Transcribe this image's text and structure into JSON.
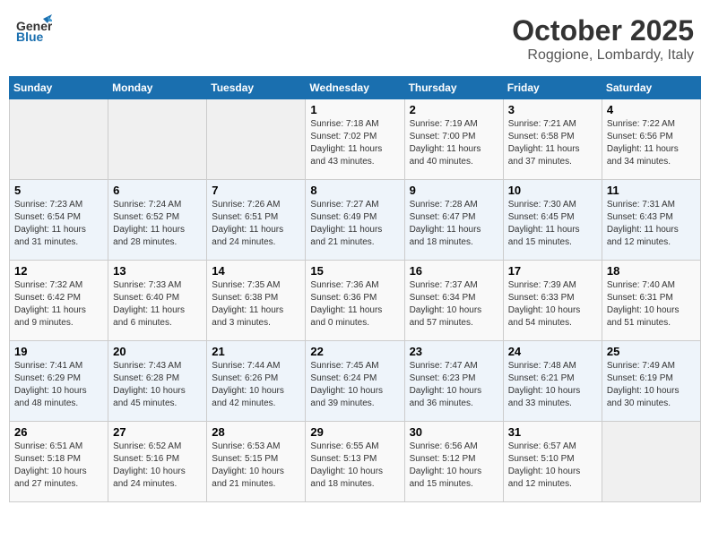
{
  "header": {
    "logo_general": "General",
    "logo_blue": "Blue",
    "month": "October 2025",
    "location": "Roggione, Lombardy, Italy"
  },
  "weekdays": [
    "Sunday",
    "Monday",
    "Tuesday",
    "Wednesday",
    "Thursday",
    "Friday",
    "Saturday"
  ],
  "weeks": [
    [
      {
        "day": "",
        "info": ""
      },
      {
        "day": "",
        "info": ""
      },
      {
        "day": "",
        "info": ""
      },
      {
        "day": "1",
        "info": "Sunrise: 7:18 AM\nSunset: 7:02 PM\nDaylight: 11 hours\nand 43 minutes."
      },
      {
        "day": "2",
        "info": "Sunrise: 7:19 AM\nSunset: 7:00 PM\nDaylight: 11 hours\nand 40 minutes."
      },
      {
        "day": "3",
        "info": "Sunrise: 7:21 AM\nSunset: 6:58 PM\nDaylight: 11 hours\nand 37 minutes."
      },
      {
        "day": "4",
        "info": "Sunrise: 7:22 AM\nSunset: 6:56 PM\nDaylight: 11 hours\nand 34 minutes."
      }
    ],
    [
      {
        "day": "5",
        "info": "Sunrise: 7:23 AM\nSunset: 6:54 PM\nDaylight: 11 hours\nand 31 minutes."
      },
      {
        "day": "6",
        "info": "Sunrise: 7:24 AM\nSunset: 6:52 PM\nDaylight: 11 hours\nand 28 minutes."
      },
      {
        "day": "7",
        "info": "Sunrise: 7:26 AM\nSunset: 6:51 PM\nDaylight: 11 hours\nand 24 minutes."
      },
      {
        "day": "8",
        "info": "Sunrise: 7:27 AM\nSunset: 6:49 PM\nDaylight: 11 hours\nand 21 minutes."
      },
      {
        "day": "9",
        "info": "Sunrise: 7:28 AM\nSunset: 6:47 PM\nDaylight: 11 hours\nand 18 minutes."
      },
      {
        "day": "10",
        "info": "Sunrise: 7:30 AM\nSunset: 6:45 PM\nDaylight: 11 hours\nand 15 minutes."
      },
      {
        "day": "11",
        "info": "Sunrise: 7:31 AM\nSunset: 6:43 PM\nDaylight: 11 hours\nand 12 minutes."
      }
    ],
    [
      {
        "day": "12",
        "info": "Sunrise: 7:32 AM\nSunset: 6:42 PM\nDaylight: 11 hours\nand 9 minutes."
      },
      {
        "day": "13",
        "info": "Sunrise: 7:33 AM\nSunset: 6:40 PM\nDaylight: 11 hours\nand 6 minutes."
      },
      {
        "day": "14",
        "info": "Sunrise: 7:35 AM\nSunset: 6:38 PM\nDaylight: 11 hours\nand 3 minutes."
      },
      {
        "day": "15",
        "info": "Sunrise: 7:36 AM\nSunset: 6:36 PM\nDaylight: 11 hours\nand 0 minutes."
      },
      {
        "day": "16",
        "info": "Sunrise: 7:37 AM\nSunset: 6:34 PM\nDaylight: 10 hours\nand 57 minutes."
      },
      {
        "day": "17",
        "info": "Sunrise: 7:39 AM\nSunset: 6:33 PM\nDaylight: 10 hours\nand 54 minutes."
      },
      {
        "day": "18",
        "info": "Sunrise: 7:40 AM\nSunset: 6:31 PM\nDaylight: 10 hours\nand 51 minutes."
      }
    ],
    [
      {
        "day": "19",
        "info": "Sunrise: 7:41 AM\nSunset: 6:29 PM\nDaylight: 10 hours\nand 48 minutes."
      },
      {
        "day": "20",
        "info": "Sunrise: 7:43 AM\nSunset: 6:28 PM\nDaylight: 10 hours\nand 45 minutes."
      },
      {
        "day": "21",
        "info": "Sunrise: 7:44 AM\nSunset: 6:26 PM\nDaylight: 10 hours\nand 42 minutes."
      },
      {
        "day": "22",
        "info": "Sunrise: 7:45 AM\nSunset: 6:24 PM\nDaylight: 10 hours\nand 39 minutes."
      },
      {
        "day": "23",
        "info": "Sunrise: 7:47 AM\nSunset: 6:23 PM\nDaylight: 10 hours\nand 36 minutes."
      },
      {
        "day": "24",
        "info": "Sunrise: 7:48 AM\nSunset: 6:21 PM\nDaylight: 10 hours\nand 33 minutes."
      },
      {
        "day": "25",
        "info": "Sunrise: 7:49 AM\nSunset: 6:19 PM\nDaylight: 10 hours\nand 30 minutes."
      }
    ],
    [
      {
        "day": "26",
        "info": "Sunrise: 6:51 AM\nSunset: 5:18 PM\nDaylight: 10 hours\nand 27 minutes."
      },
      {
        "day": "27",
        "info": "Sunrise: 6:52 AM\nSunset: 5:16 PM\nDaylight: 10 hours\nand 24 minutes."
      },
      {
        "day": "28",
        "info": "Sunrise: 6:53 AM\nSunset: 5:15 PM\nDaylight: 10 hours\nand 21 minutes."
      },
      {
        "day": "29",
        "info": "Sunrise: 6:55 AM\nSunset: 5:13 PM\nDaylight: 10 hours\nand 18 minutes."
      },
      {
        "day": "30",
        "info": "Sunrise: 6:56 AM\nSunset: 5:12 PM\nDaylight: 10 hours\nand 15 minutes."
      },
      {
        "day": "31",
        "info": "Sunrise: 6:57 AM\nSunset: 5:10 PM\nDaylight: 10 hours\nand 12 minutes."
      },
      {
        "day": "",
        "info": ""
      }
    ]
  ]
}
